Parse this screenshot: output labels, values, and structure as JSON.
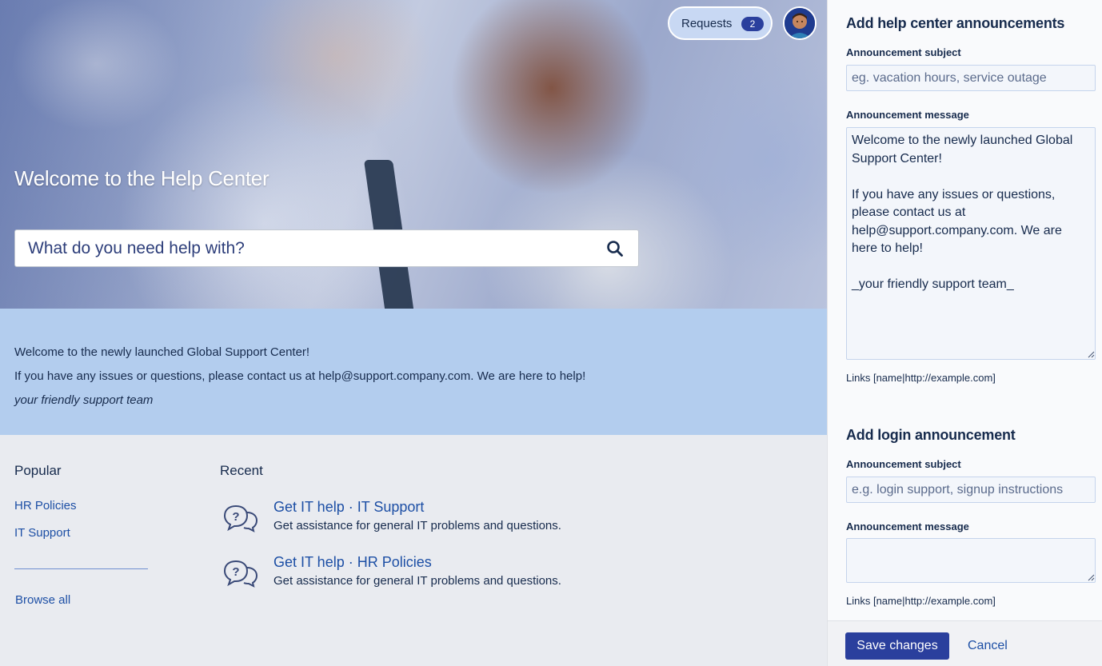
{
  "hero": {
    "title": "Welcome to the Help Center",
    "search_placeholder": "What do you need help with?"
  },
  "top_nav": {
    "requests_label": "Requests",
    "requests_count": "2"
  },
  "announcement_banner": {
    "line1": "Welcome to the newly launched Global Support Center!",
    "line2": "If you have any issues or questions, please contact us at help@support.company.com. We are here to help!",
    "line3": "your friendly support team"
  },
  "popular": {
    "title": "Popular",
    "links": [
      "HR Policies",
      "IT Support"
    ],
    "browse_all": "Browse all"
  },
  "recent": {
    "title": "Recent",
    "items": [
      {
        "link": "Get IT help · IT Support",
        "desc": "Get assistance for general IT problems and questions.",
        "icon": "chat-question-icon"
      },
      {
        "link": "Get IT help · HR Policies",
        "desc": "Get assistance for general IT problems and questions.",
        "icon": "chat-question-icon"
      }
    ]
  },
  "panel": {
    "help_center": {
      "title": "Add help center announcements",
      "subject_label": "Announcement subject",
      "subject_placeholder": "eg. vacation hours, service outage",
      "message_label": "Announcement message",
      "message_value": "Welcome to the newly launched Global Support Center!\n\nIf you have any issues or questions, please contact us at help@support.company.com. We are here to help!\n\n_your friendly support team_",
      "links_hint": "Links [name|http://example.com]"
    },
    "login": {
      "title": "Add login announcement",
      "subject_label": "Announcement subject",
      "subject_placeholder": "e.g. login support, signup instructions",
      "message_label": "Announcement message",
      "message_value": "",
      "links_hint": "Links [name|http://example.com]"
    },
    "footer": {
      "save_label": "Save changes",
      "cancel_label": "Cancel"
    }
  },
  "colors": {
    "brand_blue": "#2a3f9d",
    "link_blue": "#1d4fa5",
    "banner_bg": "#b3cdee"
  }
}
